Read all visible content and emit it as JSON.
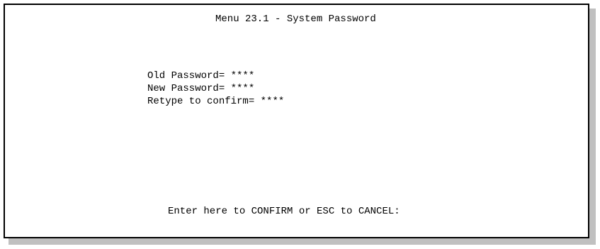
{
  "menu": {
    "title": "Menu 23.1 - System Password"
  },
  "fields": [
    {
      "label": "Old Password= ",
      "value": "****"
    },
    {
      "label": "New Password= ",
      "value": "****"
    },
    {
      "label": "Retype to confirm= ",
      "value": "****"
    }
  ],
  "prompt": "Enter here to CONFIRM or ESC to CANCEL:",
  "colors": {
    "background": "#ffffff",
    "text": "#000000",
    "shadow": "#c0c0c0"
  }
}
